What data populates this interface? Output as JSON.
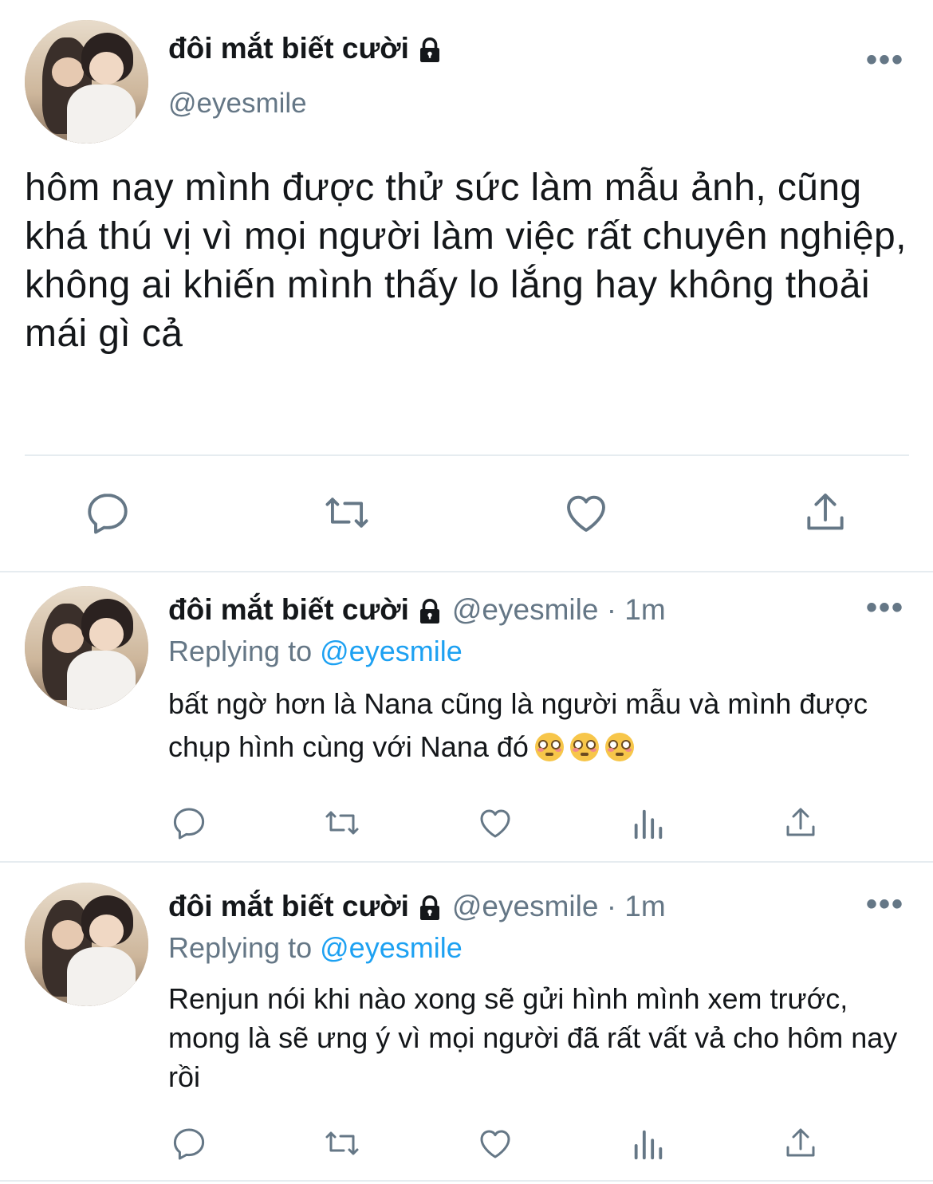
{
  "main_tweet": {
    "display_name": "đôi mắt biết cười",
    "handle": "@eyesmile",
    "text": "hôm nay mình được thử sức làm mẫu ảnh, cũng khá thú vị vì mọi người làm việc rất chuyên nghiệp, không ai khiến mình thấy lo lắng hay không thoải mái gì cả",
    "more_label": "•••",
    "actions": [
      "reply-icon",
      "retweet-icon",
      "like-icon",
      "share-icon"
    ]
  },
  "replies": [
    {
      "display_name": "đôi mắt biết cười",
      "handle_time": "@eyesmile · 1m",
      "replying_prefix": "Replying to",
      "replying_mention": "@eyesmile",
      "text": "bất ngờ hơn là Nana cũng là người mẫu và mình được chụp hình cùng với Nana đó",
      "emojis": [
        "flushed-face-emoji",
        "flushed-face-emoji",
        "flushed-face-emoji"
      ],
      "more_label": "•••",
      "actions": [
        "reply-icon",
        "retweet-icon",
        "like-icon",
        "analytics-icon",
        "share-icon"
      ]
    },
    {
      "display_name": "đôi mắt biết cười",
      "handle_time": "@eyesmile · 1m",
      "replying_prefix": "Replying to",
      "replying_mention": "@eyesmile",
      "text": "Renjun nói khi nào xong sẽ gửi hình mình xem trước, mong là sẽ ưng ý vì mọi người đã rất vất vả cho hôm nay rồi",
      "more_label": "•••",
      "actions": [
        "reply-icon",
        "retweet-icon",
        "like-icon",
        "analytics-icon",
        "share-icon"
      ]
    }
  ],
  "colors": {
    "text": "#14171a",
    "secondary": "#657786",
    "mention": "#1da1f2",
    "divider": "#e6ecf0"
  }
}
